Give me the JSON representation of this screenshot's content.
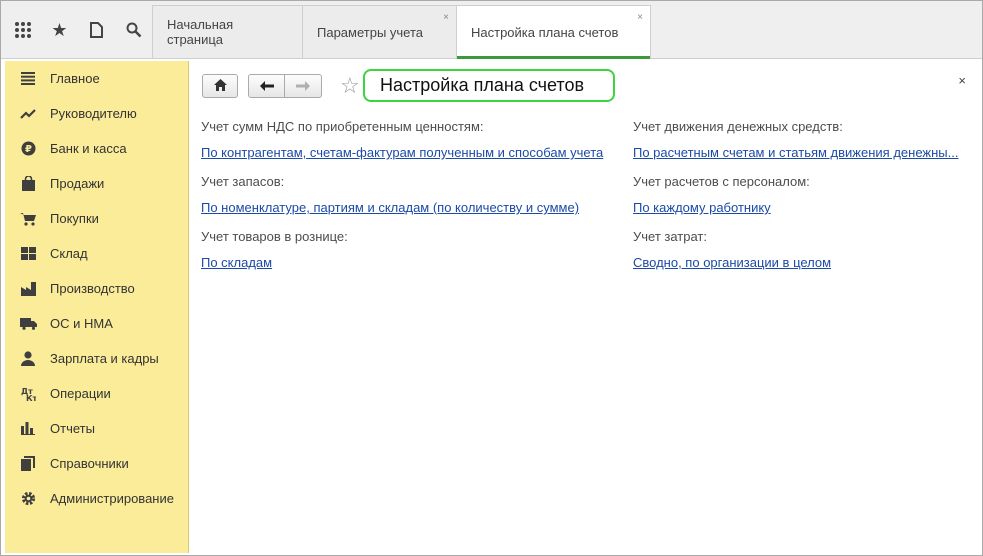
{
  "topbar": {
    "icons": [
      "apps-grid-icon",
      "favorites-star-icon",
      "history-icon",
      "search-icon"
    ],
    "tabs": [
      {
        "label": "Начальная страница",
        "closable": false,
        "active": false
      },
      {
        "label": "Параметры учета",
        "closable": true,
        "active": false
      },
      {
        "label": "Настройка плана счетов",
        "closable": true,
        "active": true
      }
    ],
    "close_glyph": "×"
  },
  "sidebar": {
    "items": [
      {
        "label": "Главное",
        "icon": "menu-lines-icon"
      },
      {
        "label": "Руководителю",
        "icon": "trend-chart-icon"
      },
      {
        "label": "Банк и касса",
        "icon": "ruble-coin-icon"
      },
      {
        "label": "Продажи",
        "icon": "shopping-bag-icon"
      },
      {
        "label": "Покупки",
        "icon": "shopping-cart-icon"
      },
      {
        "label": "Склад",
        "icon": "warehouse-grid-icon"
      },
      {
        "label": "Производство",
        "icon": "factory-icon"
      },
      {
        "label": "ОС и НМА",
        "icon": "truck-icon"
      },
      {
        "label": "Зарплата и кадры",
        "icon": "person-icon"
      },
      {
        "label": "Операции",
        "icon": "debit-credit-icon"
      },
      {
        "label": "Отчеты",
        "icon": "bar-chart-icon"
      },
      {
        "label": "Справочники",
        "icon": "books-icon"
      },
      {
        "label": "Администрирование",
        "icon": "gear-icon"
      }
    ]
  },
  "main": {
    "title": "Настройка плана счетов",
    "close_glyph": "×",
    "settings_left": [
      {
        "label": "Учет сумм НДС по приобретенным ценностям:",
        "value": "По контрагентам, счетам-фактурам полученным и способам учета"
      },
      {
        "label": "Учет запасов:",
        "value": "По номенклатуре, партиям и складам (по количеству и сумме)"
      },
      {
        "label": "Учет товаров в рознице:",
        "value": "По складам"
      }
    ],
    "settings_right": [
      {
        "label": "Учет движения денежных средств:",
        "value": "По расчетным счетам и статьям движения денежны..."
      },
      {
        "label": "Учет расчетов с персоналом:",
        "value": "По каждому работнику"
      },
      {
        "label": "Учет затрат:",
        "value": "Сводно, по организации в целом"
      }
    ]
  },
  "colors": {
    "sidebar_bg": "#fbec9a",
    "link": "#1c4aa8",
    "title_highlight": "#3ed43e",
    "active_tab_underline": "#3a9a3a"
  }
}
